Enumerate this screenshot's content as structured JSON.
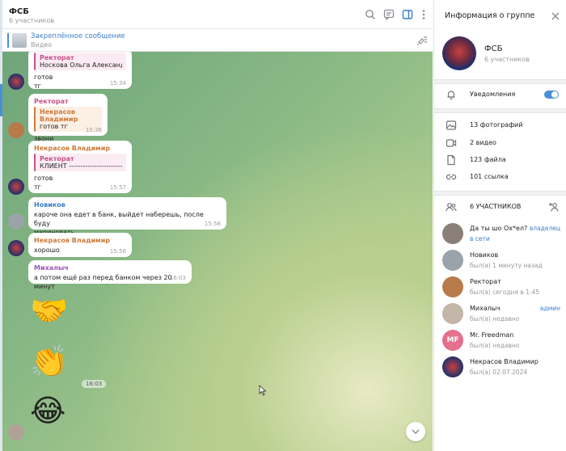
{
  "chat": {
    "title": "ФСБ",
    "subtitle": "6 участников",
    "pinned": {
      "title": "Закреплённое сообщение",
      "subtitle": "Видео"
    }
  },
  "messages": [
    {
      "reply_name": "Ректорат",
      "reply_text": "Носкова Ольга Александров...",
      "text": "готов\nтг",
      "time": "15:34"
    },
    {
      "sender": "Ректорат",
      "reply_name": "Некрасов Владимир",
      "reply_text": "готов  тг",
      "text": "звони",
      "time": "15:36"
    },
    {
      "sender": "Некрасов Владимир",
      "reply_name": "Ректорат",
      "reply_text": "КЛИЕНТ ----------------------- ПЕ...",
      "text": "готов\nтг",
      "time": "15:57"
    },
    {
      "sender": "Новиков",
      "text": "кароче она едет в банк, выйдет наберешь, после буду\nмариновать",
      "time": "15:58"
    },
    {
      "sender": "Некрасов Владимир",
      "text": "хорошо",
      "time": "15:58"
    },
    {
      "sender": "Михалыч",
      "text": "а потом ещё раз перед банком через 20 минут",
      "time": "16:03"
    }
  ],
  "stickers": {
    "time": "16:03"
  },
  "panel": {
    "title": "Информация о группе",
    "group_name": "ФСБ",
    "group_sub": "6 участников",
    "notifications_label": "Уведомления",
    "notifications_on": true,
    "media": [
      {
        "icon": "photo-icon",
        "label": "13 фотографий"
      },
      {
        "icon": "video-icon",
        "label": "2 видео"
      },
      {
        "icon": "file-icon",
        "label": "123 файла"
      },
      {
        "icon": "link-icon",
        "label": "101 ссылка"
      }
    ],
    "members_header": "6 УЧАСТНИКОВ",
    "members": [
      {
        "name": "Да ты шо Ох*ел?",
        "status": "в сети",
        "role": "владелец",
        "online": true
      },
      {
        "name": "Новиков",
        "status": "был(а) 1 минуту назад",
        "role": ""
      },
      {
        "name": "Ректорат",
        "status": "был(а) сегодня в 1:45",
        "role": ""
      },
      {
        "name": "Михалыч",
        "status": "был(а) недавно",
        "role": "админ"
      },
      {
        "name": "Mr. Freedman",
        "status": "был(а) недавно",
        "role": "",
        "initials": "MF"
      },
      {
        "name": "Некрасов Владимир",
        "status": "был(а) 02.07.2024",
        "role": ""
      }
    ]
  },
  "colors": {
    "accent": "#4a8fd6",
    "chat_bg": "#88b884",
    "mf_avatar": "#e4708d"
  }
}
